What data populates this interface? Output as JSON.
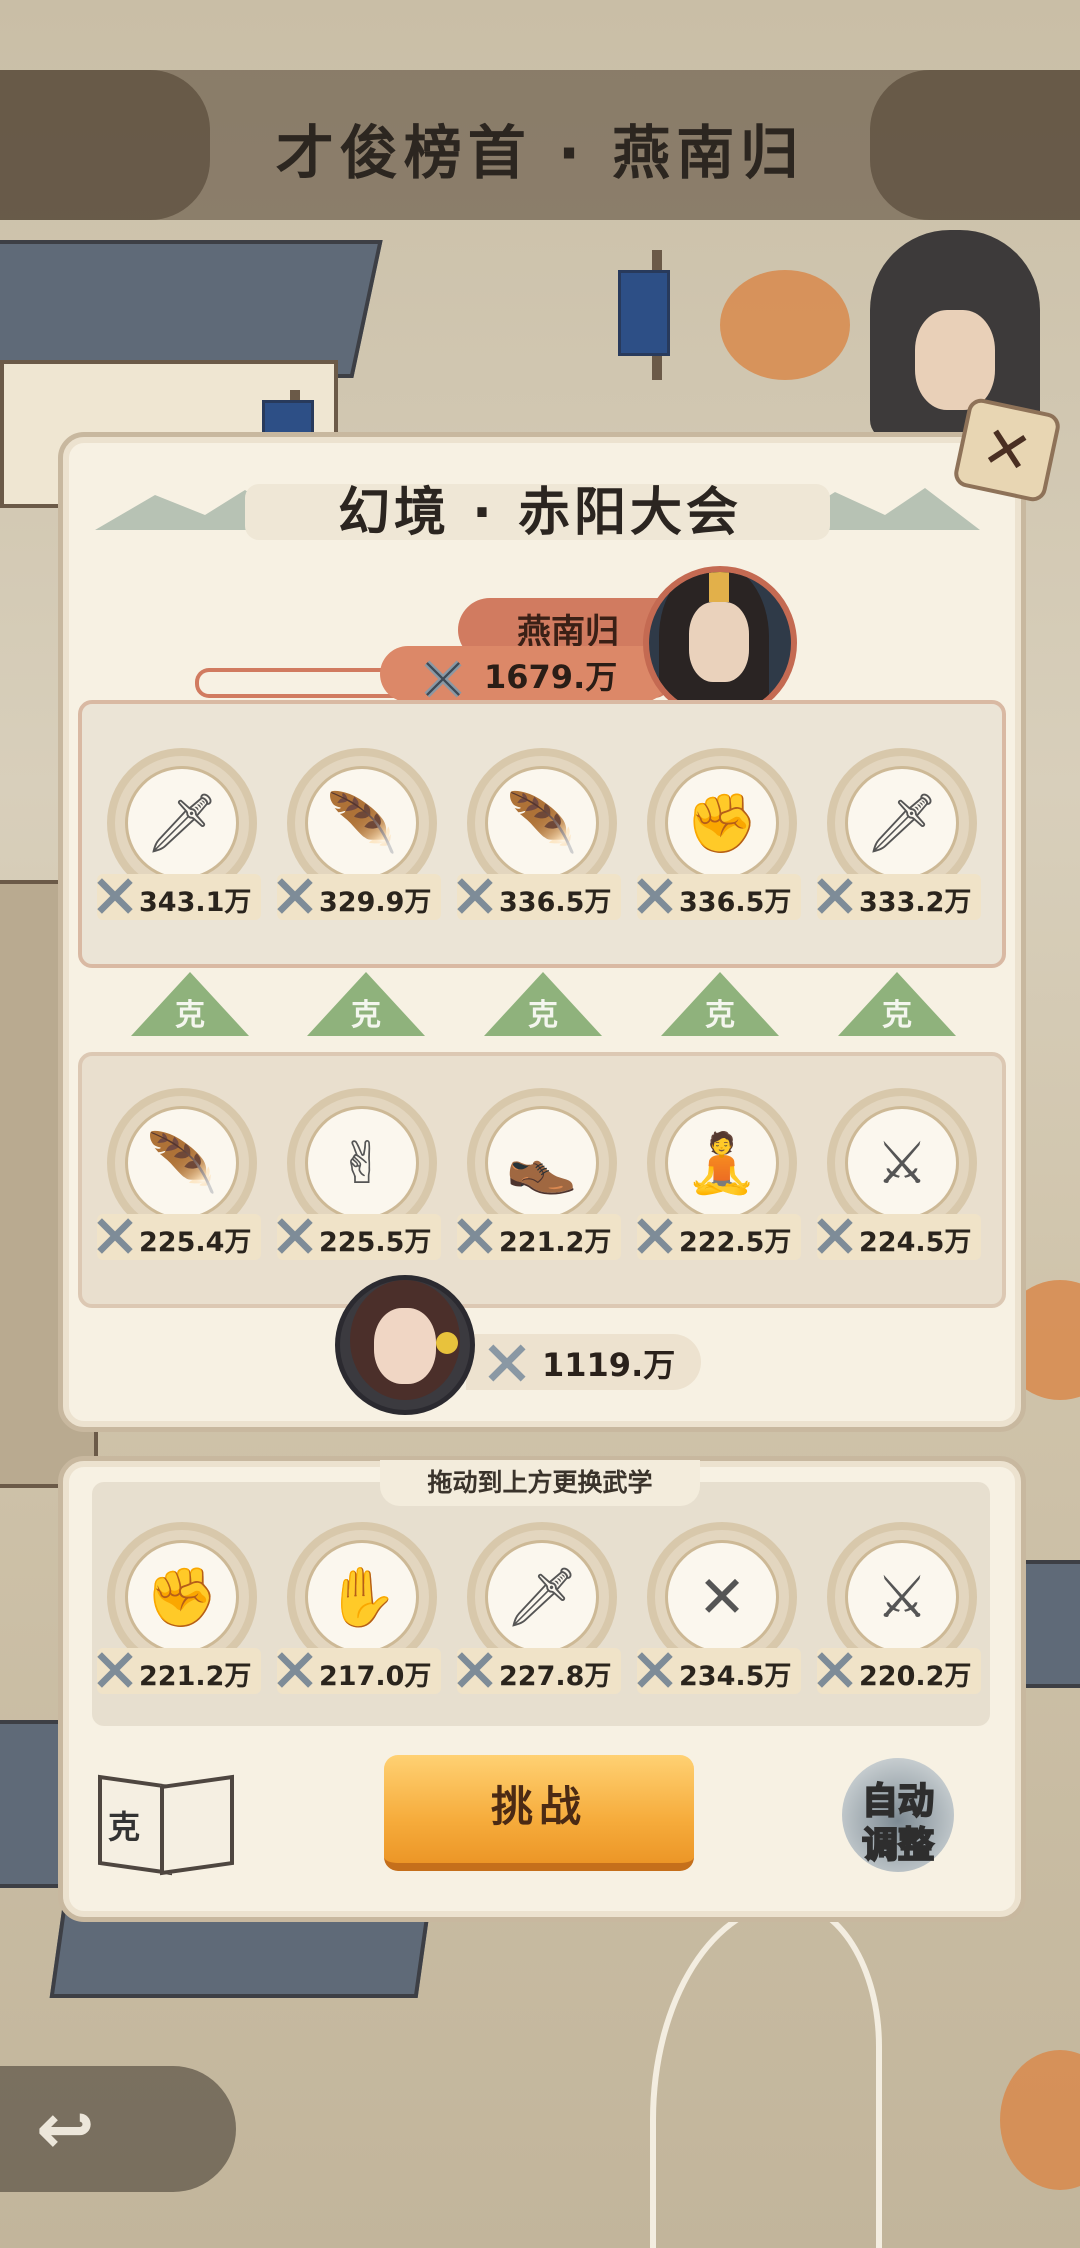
{
  "header": {
    "title": "才俊榜首 · 燕南归"
  },
  "event": {
    "title": "幻境 · 赤阳大会"
  },
  "opponent": {
    "name": "燕南归",
    "power": "1679.万",
    "skills": [
      {
        "icon": "sword-icon",
        "power": "343.1万"
      },
      {
        "icon": "feather-icon",
        "power": "329.9万"
      },
      {
        "icon": "feather-icon",
        "power": "336.5万"
      },
      {
        "icon": "fist-icon",
        "power": "336.5万"
      },
      {
        "icon": "sword-icon",
        "power": "333.2万"
      }
    ]
  },
  "counters": [
    "克",
    "克",
    "克",
    "克",
    "克"
  ],
  "player": {
    "power": "1119.万",
    "skills": [
      {
        "icon": "feather-icon",
        "power": "225.4万"
      },
      {
        "icon": "two-finger-hand-icon",
        "power": "225.5万"
      },
      {
        "icon": "boot-icon",
        "power": "221.2万"
      },
      {
        "icon": "meditation-icon",
        "power": "222.5万"
      },
      {
        "icon": "straight-sword-icon",
        "power": "224.5万"
      }
    ]
  },
  "inventory": {
    "hint": "拖动到上方更换武学",
    "skills": [
      {
        "icon": "fist-icon",
        "power": "221.2万"
      },
      {
        "icon": "palm-icon",
        "power": "217.0万"
      },
      {
        "icon": "sword-icon",
        "power": "227.8万"
      },
      {
        "icon": "crossed-spears-icon",
        "power": "234.5万"
      },
      {
        "icon": "throwing-knives-icon",
        "power": "220.2万"
      }
    ]
  },
  "actions": {
    "challenge_label": "挑战",
    "counter_book_label": "克",
    "auto_adjust_line1": "自动",
    "auto_adjust_line2": "调整"
  },
  "colors": {
    "accent": "#d17b60",
    "counter_green": "#8fb27c",
    "button_orange": "#f6ac3c"
  }
}
